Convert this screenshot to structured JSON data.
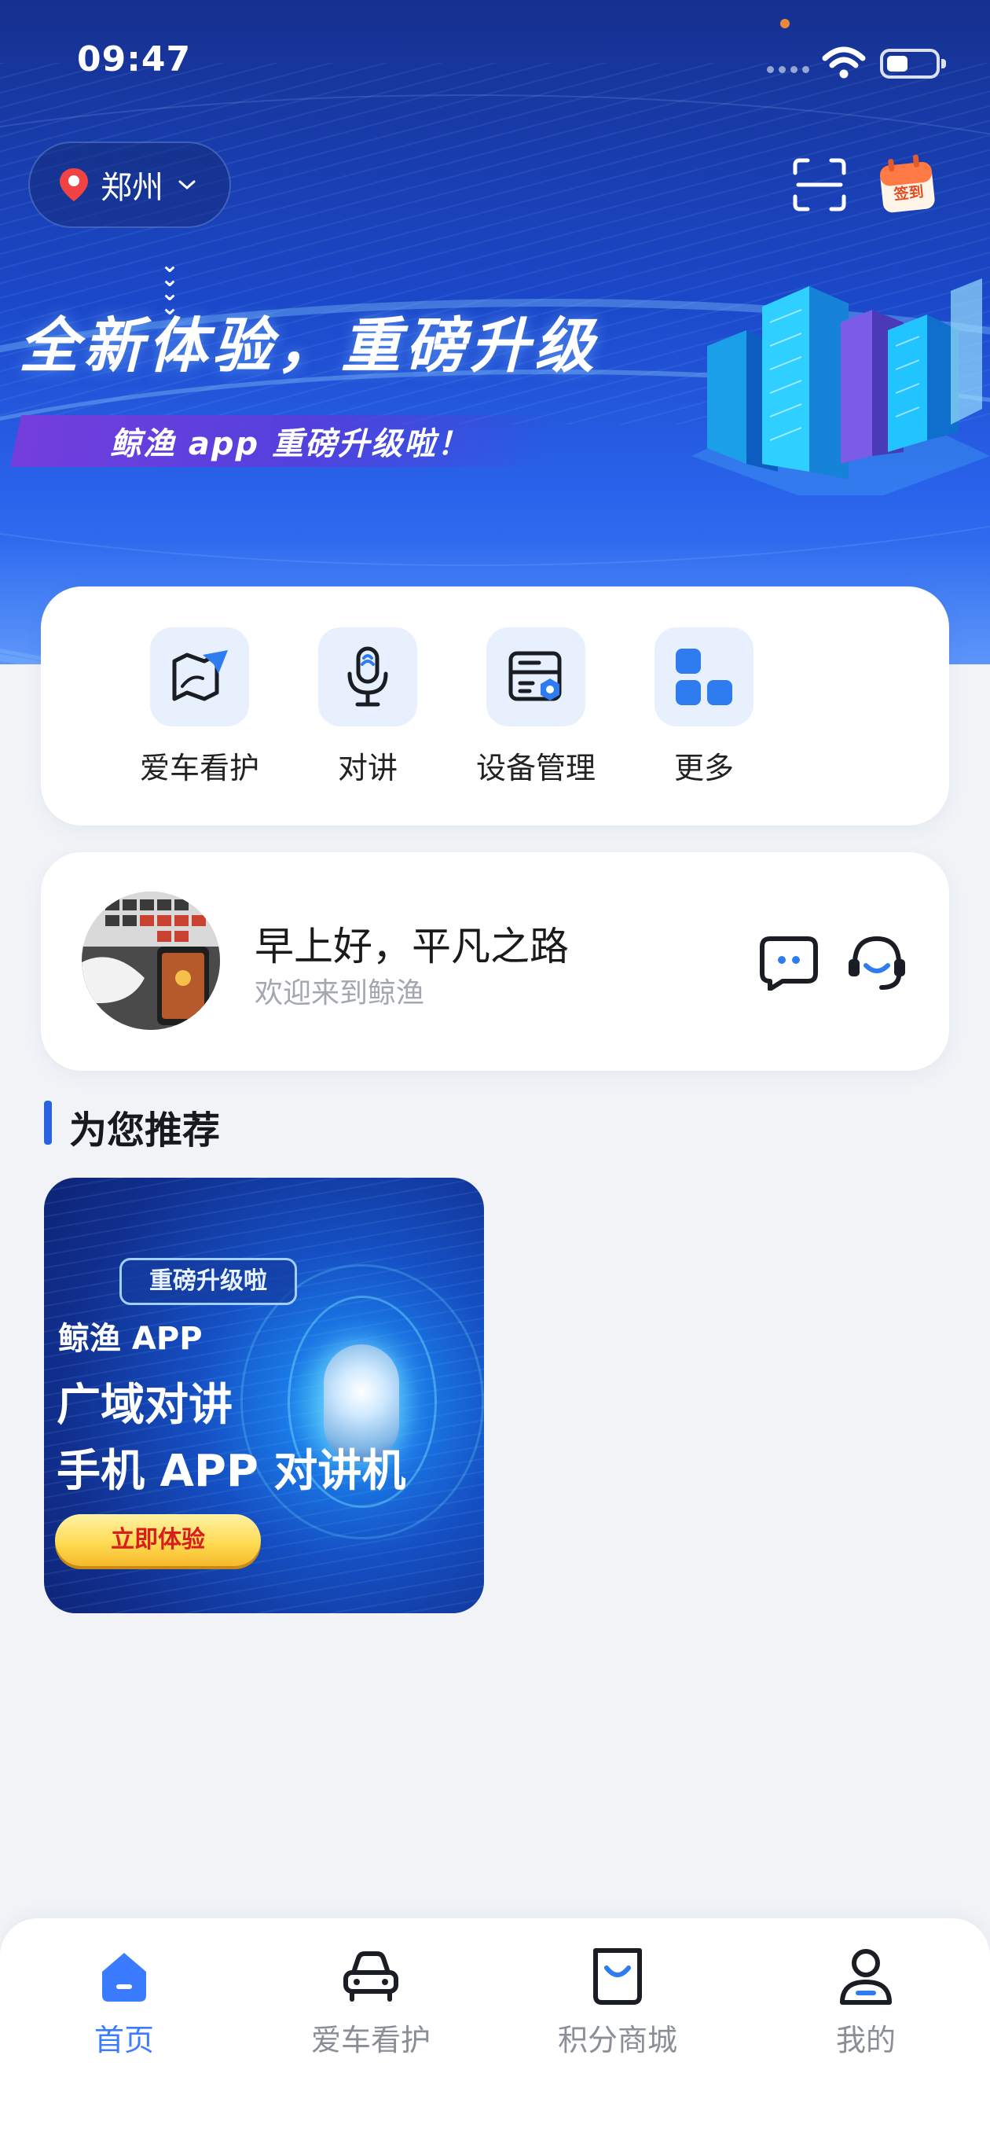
{
  "status_bar": {
    "time": "09:47"
  },
  "header": {
    "location": "郑州",
    "icons": [
      "location-pin-icon",
      "chevron-down-icon",
      "scan-icon",
      "check-in-calendar-icon"
    ],
    "checkin_label": "签到"
  },
  "banner": {
    "headline": "全新体验，重磅升级",
    "subline": "鲸渔 app 重磅升级啦！"
  },
  "quick_actions": [
    {
      "label": "爱车看护",
      "icon": "map-navigation-icon"
    },
    {
      "label": "对讲",
      "icon": "microphone-icon"
    },
    {
      "label": "设备管理",
      "icon": "device-management-icon"
    },
    {
      "label": "更多",
      "icon": "grid-more-icon"
    }
  ],
  "greeting": {
    "title": "早上好，平凡之路",
    "subtitle": "欢迎来到鲸渔",
    "icons": [
      "message-icon",
      "customer-service-icon"
    ]
  },
  "recommend": {
    "title": "为您推荐",
    "card": {
      "tag": "重磅升级啦",
      "line1": "鲸渔 APP",
      "line2": "广域对讲",
      "line3": "手机 APP 对讲机",
      "cta": "立即体验"
    }
  },
  "tabbar": {
    "active_index": 0,
    "accent_color": "#3a7bff",
    "items": [
      {
        "label": "首页",
        "icon": "home-icon"
      },
      {
        "label": "爱车看护",
        "icon": "car-icon"
      },
      {
        "label": "积分商城",
        "icon": "shopping-bag-icon"
      },
      {
        "label": "我的",
        "icon": "profile-icon"
      }
    ]
  },
  "colors": {
    "hero_top": "#16308f",
    "hero_bottom": "#3b7bf4",
    "section_accent": "#2a63e0",
    "page_background": "#f1f3f7"
  }
}
